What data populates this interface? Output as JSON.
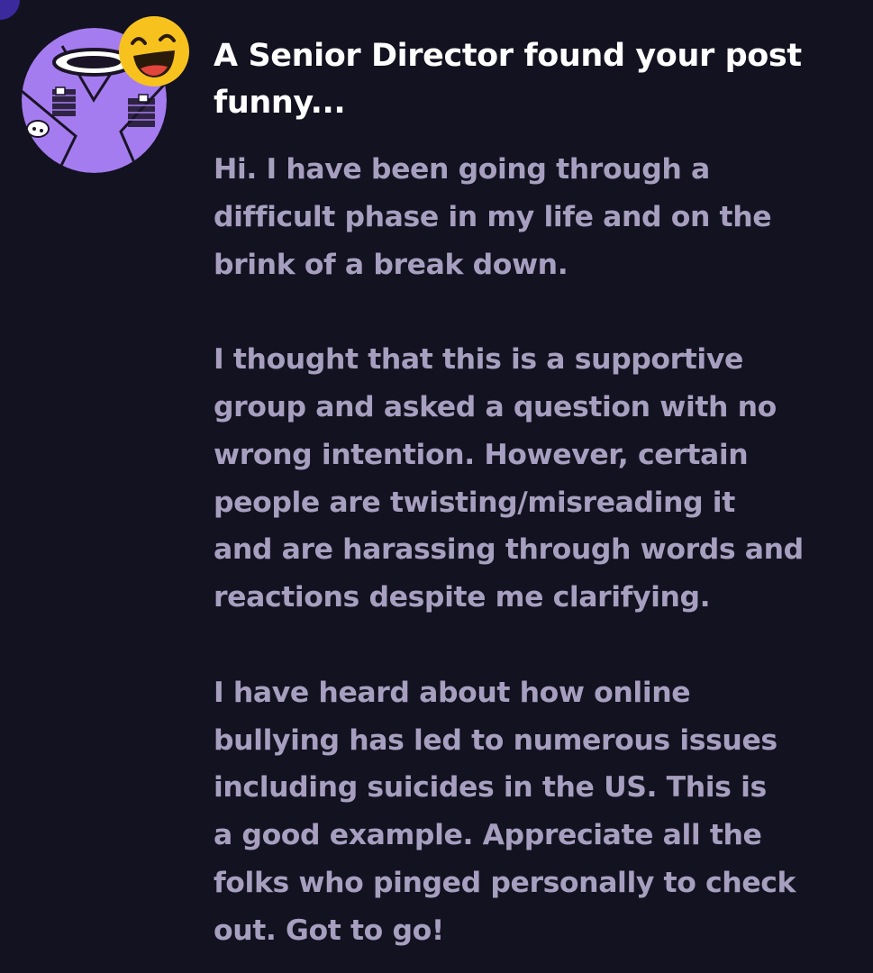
{
  "notification": {
    "avatar_icon": "illustrated-avatar",
    "reaction_icon": "laughing-emoji",
    "title_lines": [
      "A Senior Director found your post",
      "funny..."
    ],
    "message": {
      "paragraphs": [
        {
          "lines": [
            "Hi. I have been going through a",
            "difficult phase in my life and on the",
            "brink of a break down."
          ]
        },
        {
          "lines": [
            "I thought that this is a supportive",
            "group and asked a question with no",
            "wrong intention. However, certain",
            "people are twisting/misreading it",
            "and are harassing through words and",
            "reactions despite me clarifying."
          ]
        },
        {
          "lines": [
            "I have heard about how online",
            "bullying has led to numerous issues",
            "including suicides in the US. This is",
            "a good example. Appreciate all the",
            "folks who pinged personally to check",
            "out. Got to go!"
          ]
        }
      ]
    }
  },
  "colors": {
    "background": "#131220",
    "title_text": "#ffffff",
    "body_text": "#a79fbf",
    "avatar_purple": "#a57cf0",
    "emoji_yellow": "#f7c21e",
    "accent_corner": "#3a2a9e"
  }
}
